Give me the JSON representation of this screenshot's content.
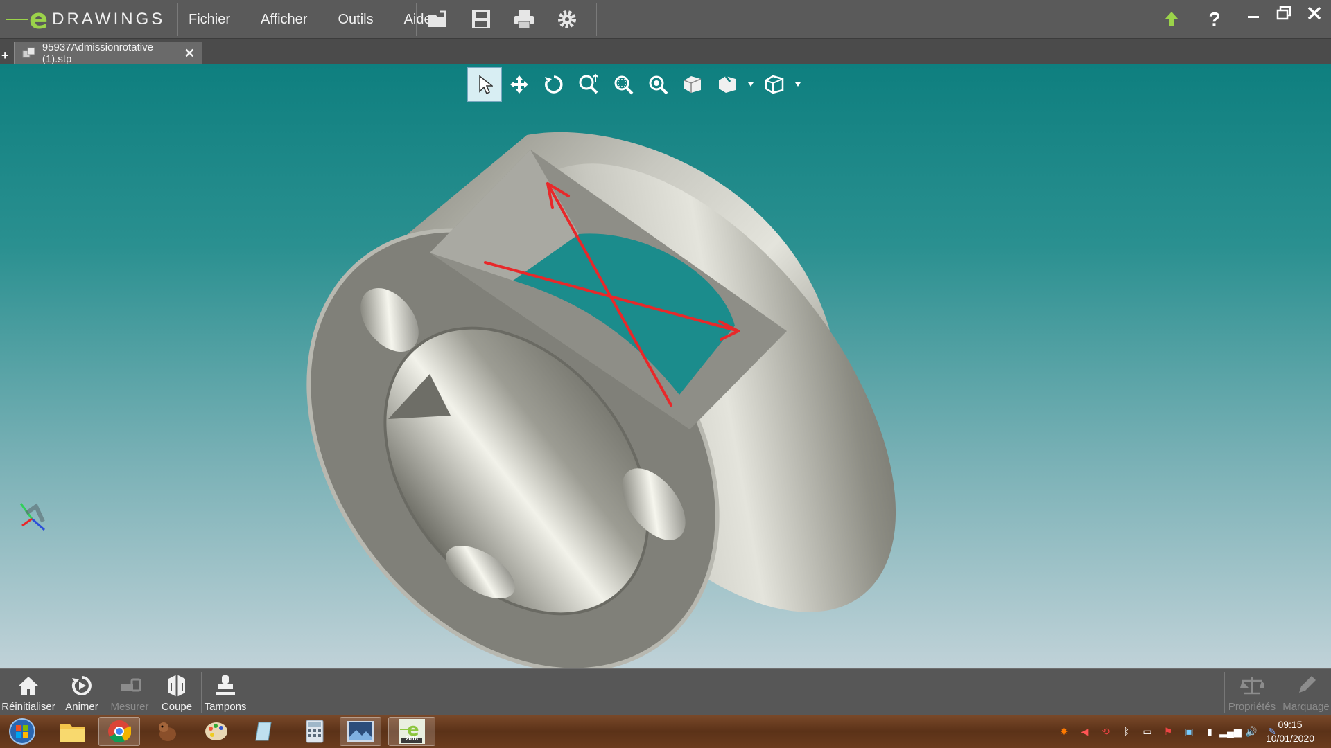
{
  "app": {
    "logo_text": "DRAWINGS",
    "logo_letter": "e",
    "menu": [
      "Fichier",
      "Afficher",
      "Outils",
      "Aide"
    ]
  },
  "toolbar": {
    "icons": [
      "open-icon",
      "save-icon",
      "print-icon",
      "settings-icon"
    ],
    "upgrade_icon": "upgrade-arrow-icon",
    "help_label": "?"
  },
  "window_controls": {
    "minimize": "minimize-icon",
    "restore": "restore-icon",
    "close": "close-icon"
  },
  "tab": {
    "label": "95937Admissionrotative (1).stp",
    "close_label": "✕",
    "new_tab_label": "+"
  },
  "view_toolbar": {
    "tools": [
      "select-icon",
      "pan-icon",
      "rotate-icon",
      "zoom-icon",
      "zoom-to-area-icon",
      "zoom-to-fit-icon",
      "shaded-view-icon",
      "view-orientation-icon",
      "display-style-icon"
    ],
    "active": "select-icon"
  },
  "bottom_tools": [
    {
      "label": "Réinitialiser",
      "icon": "home-icon",
      "enabled": true
    },
    {
      "label": "Animer",
      "icon": "animate-icon",
      "enabled": true
    },
    {
      "label": "Mesurer",
      "icon": "measure-icon",
      "enabled": false
    },
    {
      "label": "Coupe",
      "icon": "section-icon",
      "enabled": true
    },
    {
      "label": "Tampons",
      "icon": "stamp-icon",
      "enabled": true
    }
  ],
  "right_tools": [
    {
      "label": "Propriétés",
      "icon": "properties-icon",
      "enabled": false
    },
    {
      "label": "Marquage",
      "icon": "markup-icon",
      "enabled": false
    }
  ],
  "taskbar": {
    "apps": [
      "start-orb-icon",
      "file-explorer-icon",
      "chrome-icon",
      "app-dog-icon",
      "paint-icon",
      "notes-icon",
      "calculator-icon",
      "photo-viewer-icon",
      "edrawings-icon"
    ],
    "edrawings_badge": "2018",
    "clock_time": "09:15",
    "clock_date": "10/01/2020"
  },
  "colors": {
    "titlebar": "#5a5a5a",
    "viewport_top": "#0e7f7f",
    "viewport_bottom": "#c0d2d8",
    "part": "#8f8f86",
    "markup_arrow": "#e8282a"
  }
}
